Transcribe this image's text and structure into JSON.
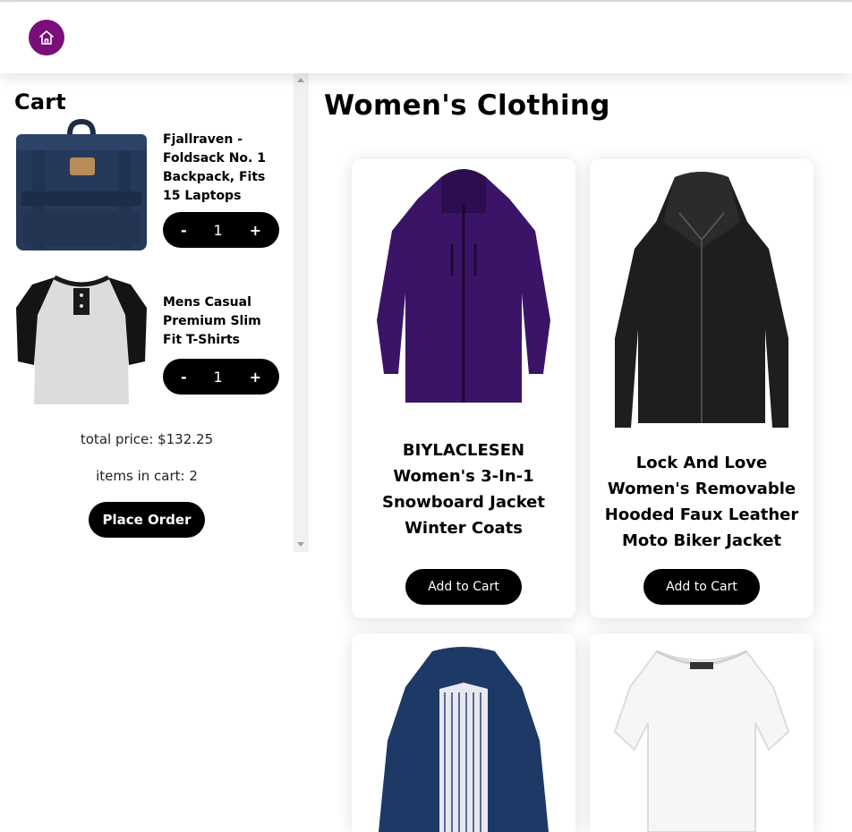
{
  "header": {
    "home_icon": "home-icon",
    "accent": "#7a0f7a"
  },
  "cart": {
    "title": "Cart",
    "items": [
      {
        "name": "Fjallraven - Foldsack No. 1 Backpack, Fits 15 Laptops",
        "minus": "-",
        "qty": "1",
        "plus": "+"
      },
      {
        "name": "Mens Casual Premium Slim Fit T-Shirts",
        "minus": "-",
        "qty": "1",
        "plus": "+"
      }
    ],
    "total_price": "total price: $132.25",
    "items_count": "items in cart: 2",
    "place_order": "Place Order"
  },
  "main": {
    "title": "Women's Clothing",
    "products": [
      {
        "title": "BIYLACLESEN Women's 3-In-1 Snowboard Jacket Winter Coats",
        "button": "Add to Cart"
      },
      {
        "title": "Lock And Love Women's Removable Hooded Faux Leather Moto Biker Jacket",
        "button": "Add to Cart"
      },
      {
        "title": "",
        "button": ""
      },
      {
        "title": "",
        "button": ""
      }
    ]
  }
}
